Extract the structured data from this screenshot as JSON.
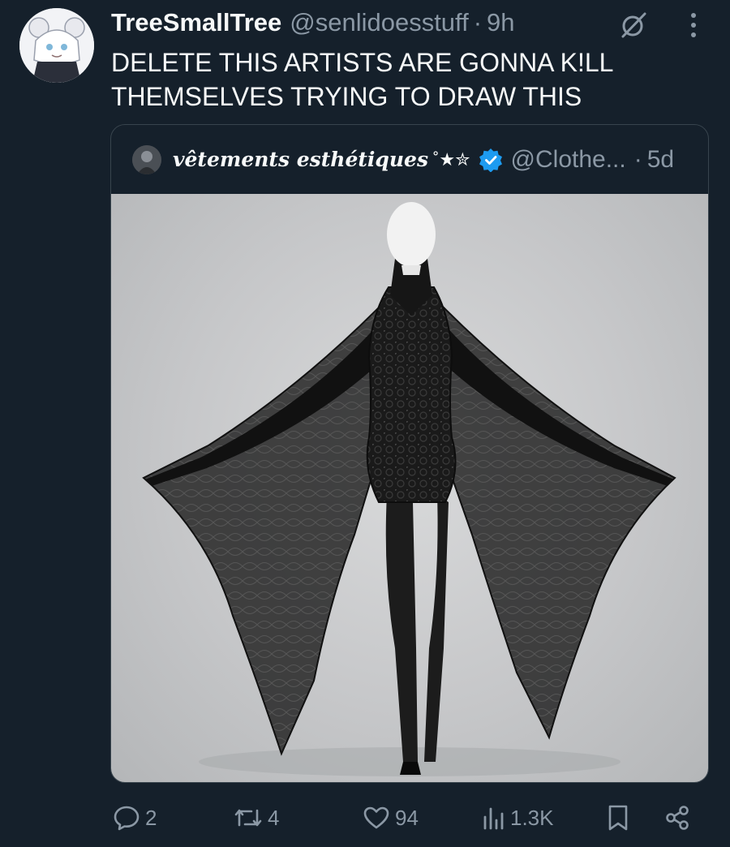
{
  "tweet": {
    "author_name": "TreeSmallTree",
    "author_handle": "@senlidoesstuff",
    "separator": "·",
    "time": "9h",
    "text_lines": [
      "DELETE THIS ARTISTS ARE GONNA K!LL",
      "THEMSELVES TRYING TO DRAW THIS"
    ]
  },
  "quote": {
    "author_name": "vêtements esthétiques",
    "name_decoration": "˚★✮",
    "author_handle": "@Clothe...",
    "separator": "·",
    "time": "5d"
  },
  "actions": {
    "reply_count": "2",
    "repost_count": "4",
    "like_count": "94",
    "view_count": "1.3K"
  },
  "icons": [
    "grok-icon",
    "more-icon",
    "verified-badge-icon",
    "reply-icon",
    "repost-icon",
    "like-icon",
    "views-icon",
    "bookmark-icon",
    "share-icon"
  ],
  "colors": {
    "background": "#15202b",
    "primary_text": "#f7f9f9",
    "secondary_text": "#8b98a5",
    "border": "#38444d",
    "verified": "#1d9bf0"
  }
}
